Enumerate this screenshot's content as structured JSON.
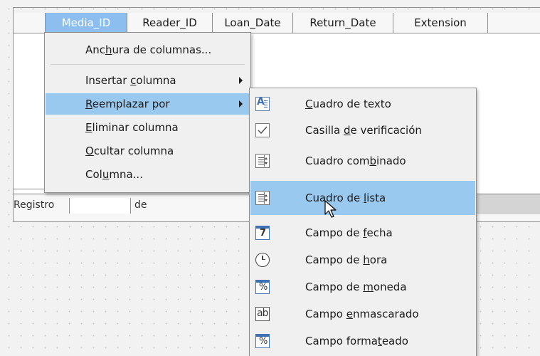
{
  "grid": {
    "columns": [
      {
        "label": "Media_ID",
        "selected": true
      },
      {
        "label": "Reader_ID",
        "selected": false
      },
      {
        "label": "Loan_Date",
        "selected": false
      },
      {
        "label": "Return_Date",
        "selected": false
      },
      {
        "label": "Extension",
        "selected": false
      }
    ]
  },
  "navigation": {
    "record_label": "Registro",
    "of_label": "de"
  },
  "context_menu": {
    "items": [
      {
        "pre": "Anc",
        "acc": "h",
        "post": "ura de columnas...",
        "submenu": false
      },
      {
        "pre": "Insertar ",
        "acc": "c",
        "post": "olumna",
        "submenu": true
      },
      {
        "pre": "",
        "acc": "R",
        "post": "eemplazar por",
        "submenu": true,
        "active": true
      },
      {
        "pre": "",
        "acc": "E",
        "post": "liminar columna",
        "submenu": false
      },
      {
        "pre": "",
        "acc": "O",
        "post": "cultar columna",
        "submenu": false
      },
      {
        "pre": "Col",
        "acc": "u",
        "post": "mna...",
        "submenu": false
      }
    ]
  },
  "replace_submenu": {
    "items": [
      {
        "icon": "text-box-icon",
        "pre": "",
        "acc": "C",
        "post": "uadro de texto"
      },
      {
        "icon": "checkbox-icon",
        "pre": "Casilla ",
        "acc": "d",
        "post": "e verificación"
      },
      {
        "icon": "combo-box-icon",
        "pre": "Cuadro com",
        "acc": "b",
        "post": "inado"
      },
      {
        "icon": "list-box-icon",
        "pre": "Cuadro de ",
        "acc": "l",
        "post": "ista",
        "active": true
      },
      {
        "icon": "date-field-icon",
        "pre": "Campo de ",
        "acc": "f",
        "post": "echa",
        "glyph": "7"
      },
      {
        "icon": "time-field-icon",
        "pre": "Campo de ",
        "acc": "h",
        "post": "ora"
      },
      {
        "icon": "currency-field-icon",
        "pre": "Campo de ",
        "acc": "m",
        "post": "oneda",
        "glyph": "%"
      },
      {
        "icon": "masked-field-icon",
        "pre": "Campo ",
        "acc": "e",
        "post": "nmascarado",
        "glyph": "ab"
      },
      {
        "icon": "formatted-field-icon",
        "pre": "Campo forma",
        "acc": "t",
        "post": "eado",
        "glyph": "%"
      }
    ]
  },
  "colors": {
    "selection": "#99c9ef",
    "selected_header": "#8cbfef",
    "menu_bg": "#f0f0f0",
    "icon_blue": "#3f6fb5"
  }
}
